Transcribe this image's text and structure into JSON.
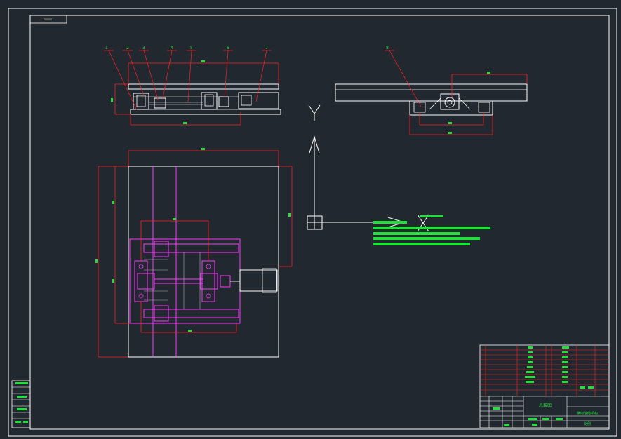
{
  "drawing": {
    "background": "#212830",
    "colors": {
      "outline": "#ffffff",
      "dimension": "#ff2020",
      "center_line": "#ff33ff",
      "highlight": "#22e03a",
      "part_line": "#b0b0b0"
    },
    "axis_labels": {
      "y_upper": "Y",
      "x_marker": "X"
    },
    "title_block": {
      "assembly_label": "总装图",
      "drawing_name": "横向进给机构",
      "scale_label": "比例"
    },
    "balloon_numbers": [
      "1",
      "2",
      "3",
      "4",
      "5",
      "6",
      "7"
    ],
    "side_balloon": "8"
  }
}
